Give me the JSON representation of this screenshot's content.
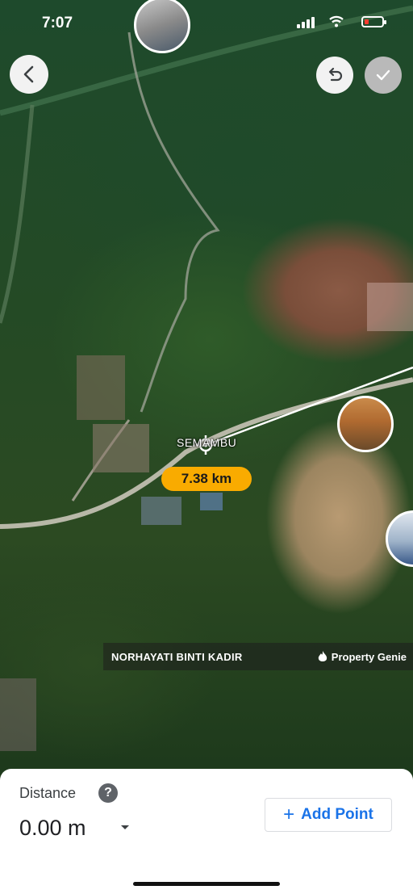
{
  "status_bar": {
    "time": "7:07",
    "battery_color": "#ff3b30"
  },
  "map": {
    "place_label": "SEMAMBU",
    "measured_distance": "7.38 km",
    "attribution_name": "NORHAYATI BINTI KADIR",
    "attribution_brand": "Property Genie",
    "pill_color": "#f9ab00"
  },
  "toolbar": {
    "back_icon": "chevron-left-icon",
    "undo_icon": "undo-icon",
    "done_icon": "check-icon"
  },
  "sheet": {
    "title": "Distance",
    "help_label": "?",
    "value": "0.00 m",
    "add_point_label": "Add Point",
    "accent": "#1a73e8"
  }
}
